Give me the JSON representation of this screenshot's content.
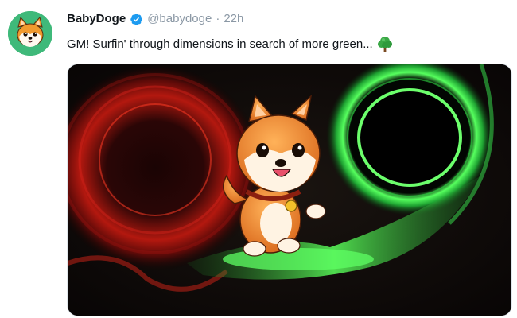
{
  "tweet": {
    "author_name": "BabyDoge",
    "verified": true,
    "handle": "@babydoge",
    "separator": "·",
    "time": "22h",
    "text": "GM! Surfin' through dimensions in search of more green...",
    "emoji": "deciduous-tree-icon"
  },
  "colors": {
    "verified_blue": "#1d9bf0",
    "handle_gray": "#8b98a5",
    "avatar_bg": "#3fb97a",
    "portal_red": "#e0281e",
    "portal_green": "#3dff57"
  }
}
